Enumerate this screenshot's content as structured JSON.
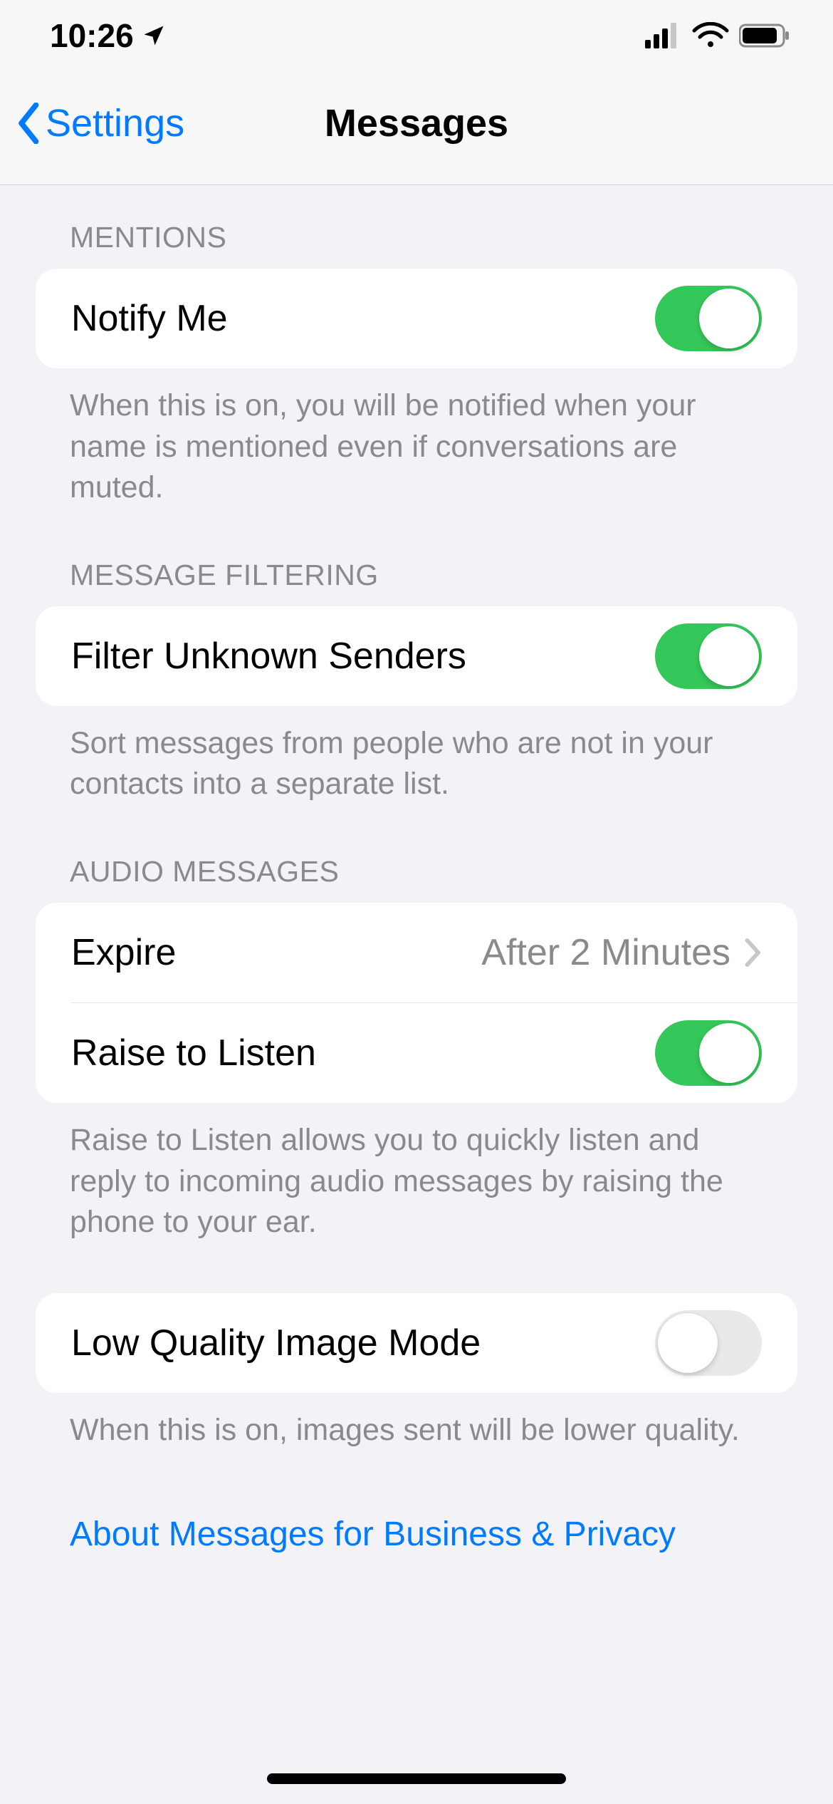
{
  "statusBar": {
    "time": "10:26"
  },
  "nav": {
    "back": "Settings",
    "title": "Messages"
  },
  "sections": {
    "mentions": {
      "header": "MENTIONS",
      "row": {
        "label": "Notify Me",
        "on": true
      },
      "footer": "When this is on, you will be notified when your name is mentioned even if conversations are muted."
    },
    "filtering": {
      "header": "MESSAGE FILTERING",
      "row": {
        "label": "Filter Unknown Senders",
        "on": true
      },
      "footer": "Sort messages from people who are not in your contacts into a separate list."
    },
    "audio": {
      "header": "AUDIO MESSAGES",
      "expire": {
        "label": "Expire",
        "value": "After 2 Minutes"
      },
      "raise": {
        "label": "Raise to Listen",
        "on": true
      },
      "footer": "Raise to Listen allows you to quickly listen and reply to incoming audio messages by raising the phone to your ear."
    },
    "lowQuality": {
      "row": {
        "label": "Low Quality Image Mode",
        "on": false
      },
      "footer": "When this is on, images sent will be lower quality."
    }
  },
  "link": "About Messages for Business & Privacy"
}
